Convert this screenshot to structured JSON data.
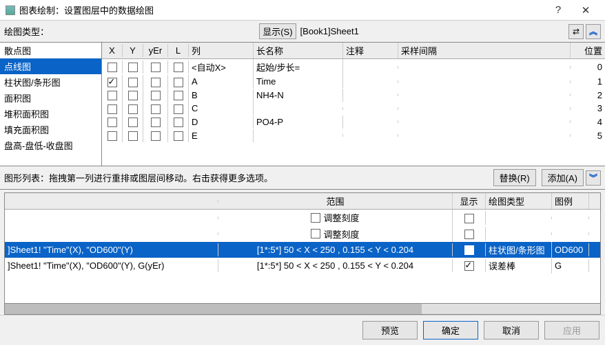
{
  "window": {
    "title": "图表绘制：设置图层中的数据绘图",
    "help": "?",
    "close": "✕"
  },
  "top": {
    "plot_type_label": "绘图类型：",
    "show_btn": "显示(S)",
    "book_path": "[Book1]Sheet1"
  },
  "left_list": {
    "items": [
      {
        "label": "散点图",
        "selected": false
      },
      {
        "label": "点线图",
        "selected": true
      },
      {
        "label": "柱状图/条形图",
        "selected": false
      },
      {
        "label": "面积图",
        "selected": false
      },
      {
        "label": "堆积面积图",
        "selected": false
      },
      {
        "label": "填充面积图",
        "selected": false
      },
      {
        "label": "盘高-盘低-收盘图",
        "selected": false
      }
    ]
  },
  "grid": {
    "headers": {
      "X": "X",
      "Y": "Y",
      "yEr": "yEr",
      "L": "L",
      "col": "列",
      "long": "长名称",
      "ann": "注释",
      "samp": "采样间隔",
      "pos": "位置"
    },
    "rows": [
      {
        "X": false,
        "Y": false,
        "yEr": false,
        "L": false,
        "col": "<自动X>",
        "long": "起始/步长=",
        "ann": "",
        "samp": "",
        "pos": "0"
      },
      {
        "X": true,
        "Y": false,
        "yEr": false,
        "L": false,
        "col": "A",
        "long": "Time",
        "ann": "",
        "samp": "",
        "pos": "1"
      },
      {
        "X": false,
        "Y": false,
        "yEr": false,
        "L": false,
        "col": "B",
        "long": "NH4-N",
        "ann": "",
        "samp": "",
        "pos": "2"
      },
      {
        "X": false,
        "Y": false,
        "yEr": false,
        "L": false,
        "col": "C",
        "long": "",
        "ann": "",
        "samp": "",
        "pos": "3"
      },
      {
        "X": false,
        "Y": false,
        "yEr": false,
        "L": false,
        "col": "D",
        "long": "PO4-P",
        "ann": "",
        "samp": "",
        "pos": "4"
      },
      {
        "X": false,
        "Y": false,
        "yEr": false,
        "L": false,
        "col": "E",
        "long": "",
        "ann": "",
        "samp": "",
        "pos": "5"
      }
    ]
  },
  "instr": {
    "text": "图形列表：拖拽第一列进行重排或图层间移动。右击获得更多选项。",
    "replace": "替换(R)",
    "add": "添加(A)"
  },
  "botgrid": {
    "headers": {
      "name": "",
      "range": "范围",
      "show": "显示",
      "type": "绘图类型",
      "legend": "图例"
    },
    "rows": [
      {
        "name": "",
        "range": "",
        "range_html": "scale",
        "scale_label": "调整刻度",
        "show": false,
        "type": "",
        "legend": "",
        "sel": false,
        "show_chk": true
      },
      {
        "name": "",
        "range": "",
        "range_html": "scale",
        "scale_label": "调整刻度",
        "show": false,
        "type": "",
        "legend": "",
        "sel": false,
        "show_chk": true
      },
      {
        "name": "]Sheet1! \"Time\"(X), \"OD600\"(Y)",
        "range": "[1*:5*]   50 < X < 250 , 0.155 < Y < 0.204",
        "show": true,
        "type": "柱状图/条形图",
        "legend": "OD600",
        "sel": true,
        "show_chk": true
      },
      {
        "name": "]Sheet1! \"Time\"(X), \"OD600\"(Y), G(yEr)",
        "range": "[1*:5*]   50 < X < 250 , 0.155 < Y < 0.204",
        "show": true,
        "type": "误差棒",
        "legend": "G",
        "sel": false,
        "show_chk": true
      }
    ]
  },
  "footer": {
    "preview": "预览",
    "ok": "确定",
    "cancel": "取消",
    "apply": "应用"
  }
}
